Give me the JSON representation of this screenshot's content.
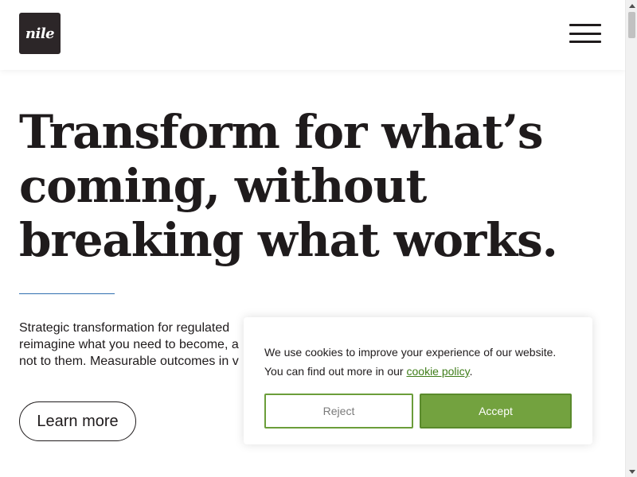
{
  "header": {
    "logo_text": "nile",
    "menu_icon": "hamburger-menu-icon"
  },
  "hero": {
    "title_line1": "Transform for what’s",
    "title_line2": "coming, without",
    "title_line3": "breaking what works.",
    "body_line1": "Strategic transformation for regulated",
    "body_line2": "reimagine what you need to become, a",
    "body_line3": "not to them. Measurable outcomes in v",
    "learn_more_label": "Learn more"
  },
  "cookie_banner": {
    "text_line1": "We use cookies to improve your experience of our website.",
    "text_line2_prefix": "You can find out more in our ",
    "link_label": "cookie policy",
    "text_line2_suffix": ".",
    "reject_label": "Reject",
    "accept_label": "Accept"
  },
  "colors": {
    "logo_bg": "#2c2628",
    "text": "#1f1b1c",
    "accent_rule": "#2f6fb0",
    "accept_bg": "#73a23f",
    "link": "#3f7d1a"
  }
}
